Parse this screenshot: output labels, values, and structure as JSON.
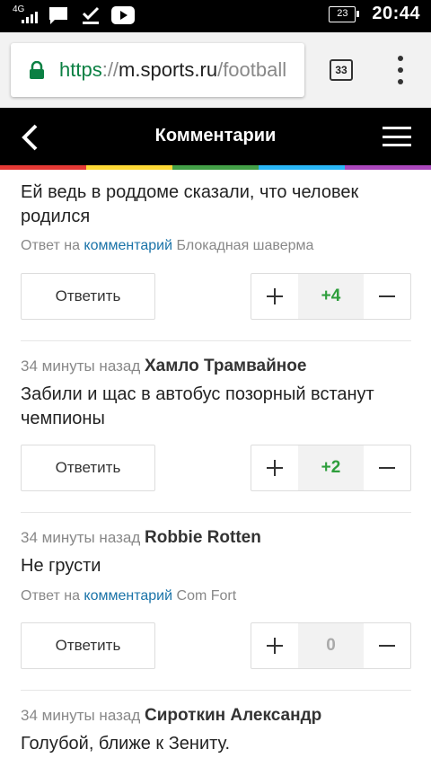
{
  "status_bar": {
    "network": "4G",
    "battery": "23",
    "time": "20:44"
  },
  "browser": {
    "url_scheme": "https",
    "url_sep": "://",
    "url_host": "m.sports.ru",
    "url_path": "/football",
    "tab_count": "33"
  },
  "header": {
    "title": "Комментарии"
  },
  "stripe_colors": [
    "#e53935",
    "#fdd835",
    "#43a047",
    "#29b6f6",
    "#ab47bc"
  ],
  "labels": {
    "reply_button": "Ответить",
    "reply_to_prefix": "Ответ на",
    "reply_to_link": "комментарий"
  },
  "comments": [
    {
      "text": "Ей ведь в роддоме сказали, что человек родился",
      "reply_to": "Блокадная шаверма",
      "score": "+4"
    },
    {
      "time": "34 минуты назад",
      "author": "Хамло Трамвайное",
      "text": "Забили и щас в автобус позорный встанут чемпионы",
      "score": "+2"
    },
    {
      "time": "34 минуты назад",
      "author": "Robbie Rotten",
      "text": "Не грусти",
      "reply_to": "Com Fort",
      "score": "0"
    },
    {
      "time": "34 минуты назад",
      "author": "Сироткин Александр",
      "text": "Голубой, ближе к Зениту."
    }
  ]
}
